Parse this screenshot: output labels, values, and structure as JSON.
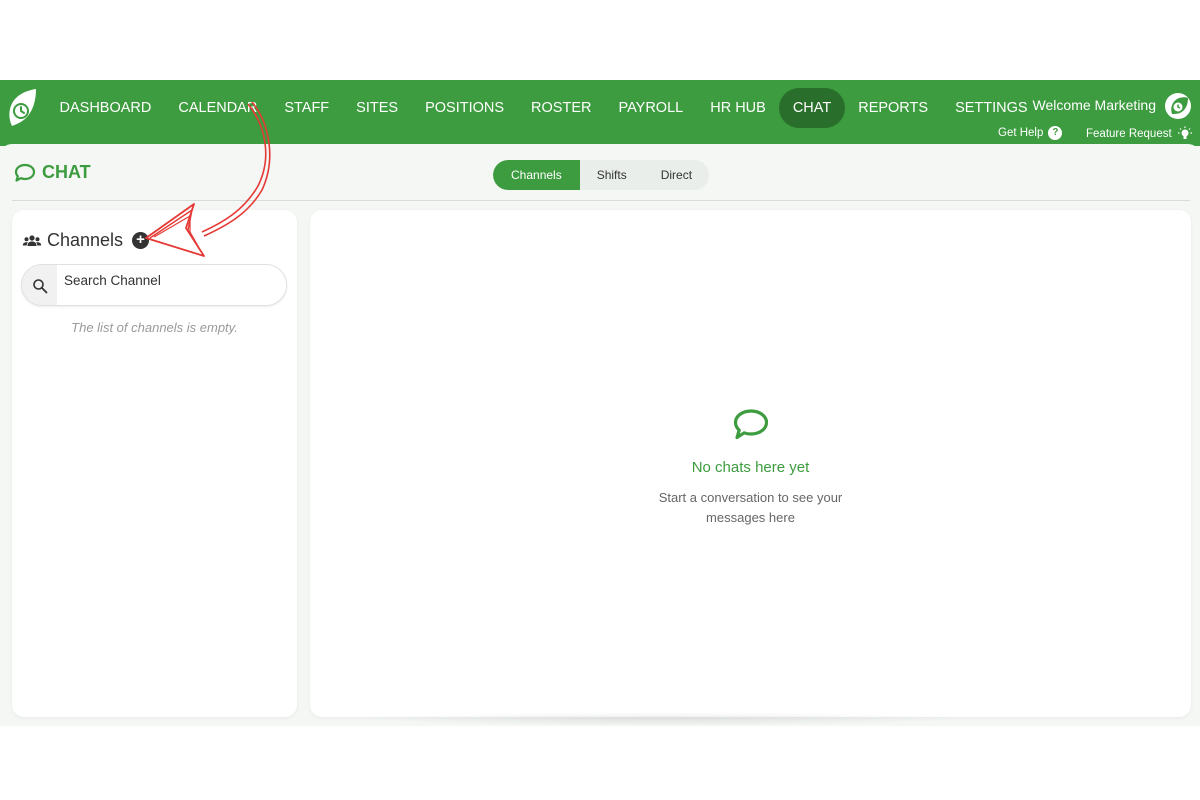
{
  "nav": {
    "items": [
      {
        "label": "DASHBOARD",
        "active": false
      },
      {
        "label": "CALENDAR",
        "active": false
      },
      {
        "label": "STAFF",
        "active": false
      },
      {
        "label": "SITES",
        "active": false
      },
      {
        "label": "POSITIONS",
        "active": false
      },
      {
        "label": "ROSTER",
        "active": false
      },
      {
        "label": "PAYROLL",
        "active": false
      },
      {
        "label": "HR HUB",
        "active": false
      },
      {
        "label": "CHAT",
        "active": true
      },
      {
        "label": "REPORTS",
        "active": false
      },
      {
        "label": "SETTINGS",
        "active": false
      }
    ],
    "welcome": "Welcome Marketing",
    "get_help": "Get Help",
    "feature_request": "Feature Request"
  },
  "page": {
    "title": "CHAT",
    "tabs": [
      {
        "label": "Channels",
        "active": true
      },
      {
        "label": "Shifts",
        "active": false
      },
      {
        "label": "Direct",
        "active": false
      }
    ]
  },
  "sidebar": {
    "heading": "Channels",
    "search_placeholder": "Search Channel",
    "empty_text": "The list of channels is empty."
  },
  "main": {
    "empty_title": "No chats here yet",
    "empty_subtitle": "Start a conversation to see your messages here"
  },
  "colors": {
    "brand": "#3d9c3f",
    "brand_dark": "#2a6e2c",
    "annotation": "#e53935"
  },
  "icons": [
    "logo-icon",
    "avatar-icon",
    "help-icon",
    "lightbulb-icon",
    "chat-bubble-icon",
    "users-icon",
    "plus-circle-icon",
    "search-icon"
  ]
}
